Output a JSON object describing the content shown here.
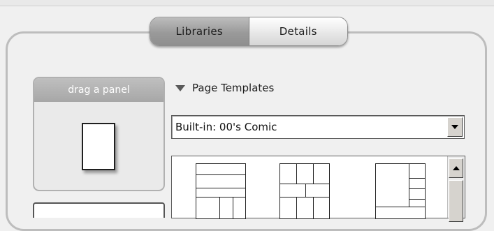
{
  "tabs": [
    {
      "label": "Libraries",
      "active": true
    },
    {
      "label": "Details",
      "active": false
    }
  ],
  "drag_panel": {
    "label": "drag a panel"
  },
  "page_templates": {
    "section_label": "Page Templates",
    "selected_template_set": "Built-in: 00's Comic"
  },
  "icons": {
    "disclosure": "triangle-down-icon",
    "dropdown": "dropdown-arrow-icon",
    "scroll_up": "scroll-up-arrow-icon"
  },
  "colors": {
    "active_tab": "#9a9a9a",
    "inactive_tab": "#e8e8e8",
    "frame": "#bdbdbd",
    "background": "#f0f0f0"
  }
}
